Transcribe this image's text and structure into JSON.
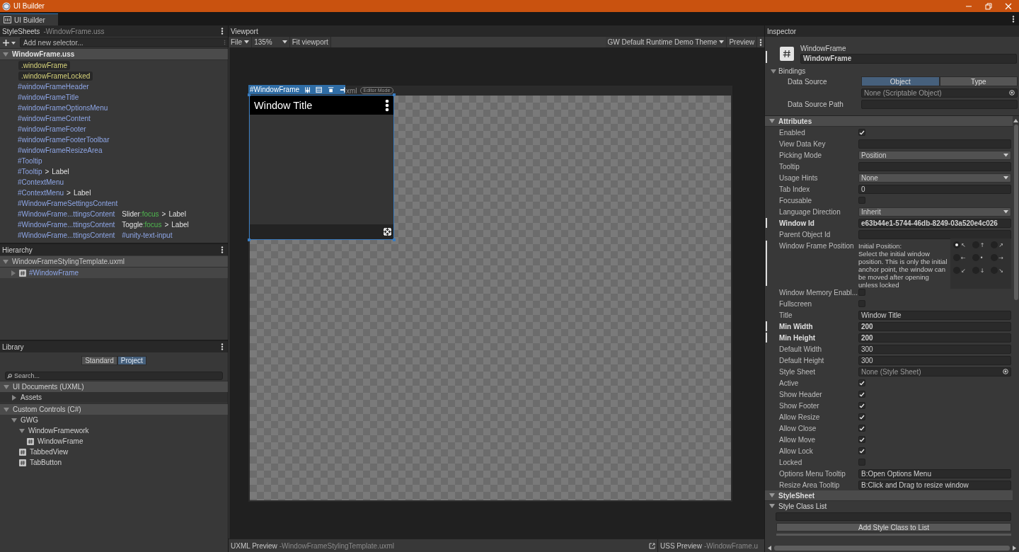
{
  "window": {
    "title": "UI Builder"
  },
  "tab": {
    "label": "UI Builder"
  },
  "stylesheets": {
    "title": "StyleSheets",
    "subtitle": "-WindowFrame.uss",
    "selector_field": {
      "placeholder": "Add new selector..."
    },
    "file": {
      "label": "WindowFrame.uss",
      "expanded": true
    },
    "selectors": [
      {
        "parts": [
          {
            "text": ".windowFrame",
            "kind": "class"
          }
        ]
      },
      {
        "parts": [
          {
            "text": ".windowFrameLocked",
            "kind": "class"
          }
        ]
      },
      {
        "parts": [
          {
            "text": "#windowFrameHeader",
            "kind": "id"
          }
        ]
      },
      {
        "parts": [
          {
            "text": "#windowFrameTitle",
            "kind": "id"
          }
        ]
      },
      {
        "parts": [
          {
            "text": "#windowFrameOptionsMenu",
            "kind": "id"
          }
        ]
      },
      {
        "parts": [
          {
            "text": "#windowFrameContent",
            "kind": "id"
          }
        ]
      },
      {
        "parts": [
          {
            "text": "#windowFrameFooter",
            "kind": "id"
          }
        ]
      },
      {
        "parts": [
          {
            "text": "#windowFrameFooterToolbar",
            "kind": "id"
          }
        ]
      },
      {
        "parts": [
          {
            "text": "#windowFrameResizeArea",
            "kind": "id"
          }
        ]
      },
      {
        "parts": [
          {
            "text": "#Tooltip",
            "kind": "id"
          }
        ]
      },
      {
        "parts": [
          {
            "text": "#Tooltip",
            "kind": "id"
          },
          {
            "text": ">",
            "kind": "combinator"
          },
          {
            "text": "Label",
            "kind": "type"
          }
        ]
      },
      {
        "parts": [
          {
            "text": "#ContextMenu",
            "kind": "id"
          }
        ]
      },
      {
        "parts": [
          {
            "text": "#ContextMenu",
            "kind": "id"
          },
          {
            "text": ">",
            "kind": "combinator"
          },
          {
            "text": "Label",
            "kind": "type"
          }
        ]
      },
      {
        "parts": [
          {
            "text": "#WindowFrameSettingsContent",
            "kind": "id"
          }
        ]
      },
      {
        "parts": [
          {
            "text": "#WindowFrame...ttingsContent",
            "kind": "id"
          },
          {
            "text": "Slider",
            "kind": "type"
          },
          {
            "text": ":focus",
            "kind": "pseudo"
          },
          {
            "text": ">",
            "kind": "combinator"
          },
          {
            "text": "Label",
            "kind": "type"
          }
        ]
      },
      {
        "parts": [
          {
            "text": "#WindowFrame...ttingsContent",
            "kind": "id"
          },
          {
            "text": "Toggle",
            "kind": "type"
          },
          {
            "text": ":focus",
            "kind": "pseudo"
          },
          {
            "text": ">",
            "kind": "combinator"
          },
          {
            "text": "Label",
            "kind": "type"
          }
        ]
      },
      {
        "parts": [
          {
            "text": "#WindowFrame...ttingsContent",
            "kind": "id"
          },
          {
            "text": "#unity-text-input",
            "kind": "id"
          }
        ]
      }
    ]
  },
  "hierarchy": {
    "title": "Hierarchy",
    "root": {
      "label": "WindowFrameStylingTemplate.uxml",
      "expanded": true,
      "children": [
        {
          "label": "#WindowFrame",
          "expanded": false,
          "selected": true
        }
      ]
    }
  },
  "library": {
    "title": "Library",
    "toggles": [
      {
        "label": "Standard",
        "selected": false
      },
      {
        "label": "Project",
        "selected": true
      }
    ],
    "search": {
      "placeholder": "Search..."
    },
    "sections": [
      {
        "label": "UI Documents (UXML)",
        "kind": "section",
        "expanded": true,
        "children": [
          {
            "label": "Assets",
            "kind": "folder",
            "expanded": false
          }
        ]
      },
      {
        "label": "Custom Controls (C#)",
        "kind": "section",
        "expanded": true,
        "children": [
          {
            "label": "GWG",
            "kind": "folder",
            "expanded": true,
            "children": [
              {
                "label": "WindowFramework",
                "kind": "folder",
                "expanded": true,
                "children": [
                  {
                    "label": "WindowFrame",
                    "kind": "control"
                  }
                ]
              },
              {
                "label": "TabbedView",
                "kind": "control"
              },
              {
                "label": "TabButton",
                "kind": "control"
              }
            ]
          }
        ]
      }
    ]
  },
  "viewport": {
    "title": "Viewport",
    "toolbar": {
      "file_menu": "File",
      "zoom": "135%",
      "fit": "Fit viewport",
      "theme": "GW Default Runtime Demo Theme",
      "preview": "Preview"
    },
    "canvas": {
      "document_label": "xml",
      "mode_badge": "Editor Mode",
      "selection_label": "#WindowFrame",
      "window_frame": {
        "title": "Window Title"
      }
    }
  },
  "previews": [
    {
      "title": "UXML Preview",
      "file": "-WindowFrameStylingTemplate.uxml"
    },
    {
      "title": "USS Preview",
      "file": "-WindowFrame.u"
    }
  ],
  "inspector": {
    "title": "Inspector",
    "element": {
      "type": "WindowFrame",
      "name": "WindowFrame",
      "overridden": true
    },
    "bindings": {
      "label": "Bindings",
      "expanded": true,
      "data_source": {
        "label": "Data Source",
        "options": [
          {
            "label": "Object",
            "selected": true
          },
          {
            "label": "Type",
            "selected": false
          }
        ],
        "object_value": "None (Scriptable Object)"
      },
      "path": {
        "label": "Data Source Path"
      }
    },
    "attributes": {
      "label": "Attributes",
      "expanded": true,
      "rows": [
        {
          "label": "Enabled",
          "kind": "checkbox",
          "checked": true,
          "overridden": false
        },
        {
          "label": "View Data Key",
          "kind": "text",
          "overridden": false
        },
        {
          "label": "Picking Mode",
          "kind": "dropdown",
          "value": "Position",
          "overridden": false
        },
        {
          "label": "Tooltip",
          "kind": "text",
          "overridden": false
        },
        {
          "label": "Usage Hints",
          "kind": "dropdown",
          "value": "None",
          "overridden": false
        },
        {
          "label": "Tab Index",
          "kind": "text",
          "value": "0",
          "overridden": false
        },
        {
          "label": "Focusable",
          "kind": "checkbox",
          "checked": false,
          "overridden": false
        },
        {
          "label": "Language Direction",
          "kind": "dropdown",
          "value": "Inherit",
          "overridden": false
        },
        {
          "label": "Window Id",
          "kind": "text",
          "value": "e63b44e1-5744-46db-8249-03a520e4c026",
          "overridden": true
        },
        {
          "label": "Parent Object Id",
          "kind": "text",
          "overridden": false
        },
        {
          "label": "Window Frame Position",
          "kind": "position",
          "overridden": true,
          "heading": "Initial Position:",
          "description": "Select the initial window position. This is only the initial anchor point, the window can be moved after opening unless locked",
          "options": [
            {
              "arrow": "↖",
              "selected": true
            },
            {
              "arrow": "↑",
              "selected": false
            },
            {
              "arrow": "↗",
              "selected": false
            },
            {
              "arrow": "←",
              "selected": false
            },
            {
              "arrow": "•",
              "selected": false
            },
            {
              "arrow": "→",
              "selected": false
            },
            {
              "arrow": "↙",
              "selected": false
            },
            {
              "arrow": "↓",
              "selected": false
            },
            {
              "arrow": "↘",
              "selected": false
            }
          ]
        },
        {
          "label": "Window Memory Enabl...",
          "kind": "checkbox",
          "checked": false,
          "overridden": false
        },
        {
          "label": "Fullscreen",
          "kind": "checkbox",
          "checked": false,
          "overridden": false
        },
        {
          "label": "Title",
          "kind": "text",
          "value": "Window Title",
          "overridden": false
        },
        {
          "label": "Min Width",
          "kind": "text",
          "value": "200",
          "overridden": true
        },
        {
          "label": "Min Height",
          "kind": "text",
          "value": "200",
          "overridden": true
        },
        {
          "label": "Default Width",
          "kind": "text",
          "value": "300",
          "overridden": false
        },
        {
          "label": "Default Height",
          "kind": "text",
          "value": "300",
          "overridden": false
        },
        {
          "label": "Style Sheet",
          "kind": "object",
          "value": "None (Style Sheet)",
          "overridden": false
        },
        {
          "label": "Active",
          "kind": "checkbox",
          "checked": true,
          "overridden": false
        },
        {
          "label": "Show Header",
          "kind": "checkbox",
          "checked": true,
          "overridden": false
        },
        {
          "label": "Show Footer",
          "kind": "checkbox",
          "checked": true,
          "overridden": false
        },
        {
          "label": "Allow Resize",
          "kind": "checkbox",
          "checked": true,
          "overridden": false
        },
        {
          "label": "Allow Close",
          "kind": "checkbox",
          "checked": true,
          "overridden": false
        },
        {
          "label": "Allow Move",
          "kind": "checkbox",
          "checked": true,
          "overridden": false
        },
        {
          "label": "Allow Lock",
          "kind": "checkbox",
          "checked": true,
          "overridden": false
        },
        {
          "label": "Locked",
          "kind": "checkbox",
          "checked": false,
          "overridden": false
        },
        {
          "label": "Options Menu Tooltip",
          "kind": "text",
          "value": "B:Open Options Menu",
          "overridden": false
        },
        {
          "label": "Resize Area Tooltip",
          "kind": "text",
          "value": "B:Click and Drag to resize window",
          "overridden": false
        }
      ]
    },
    "stylesheet": {
      "label": "StyleSheet",
      "expanded": true,
      "class_list": {
        "label": "Style Class List",
        "expanded": true,
        "add_button": "Add Style Class to List"
      }
    }
  }
}
